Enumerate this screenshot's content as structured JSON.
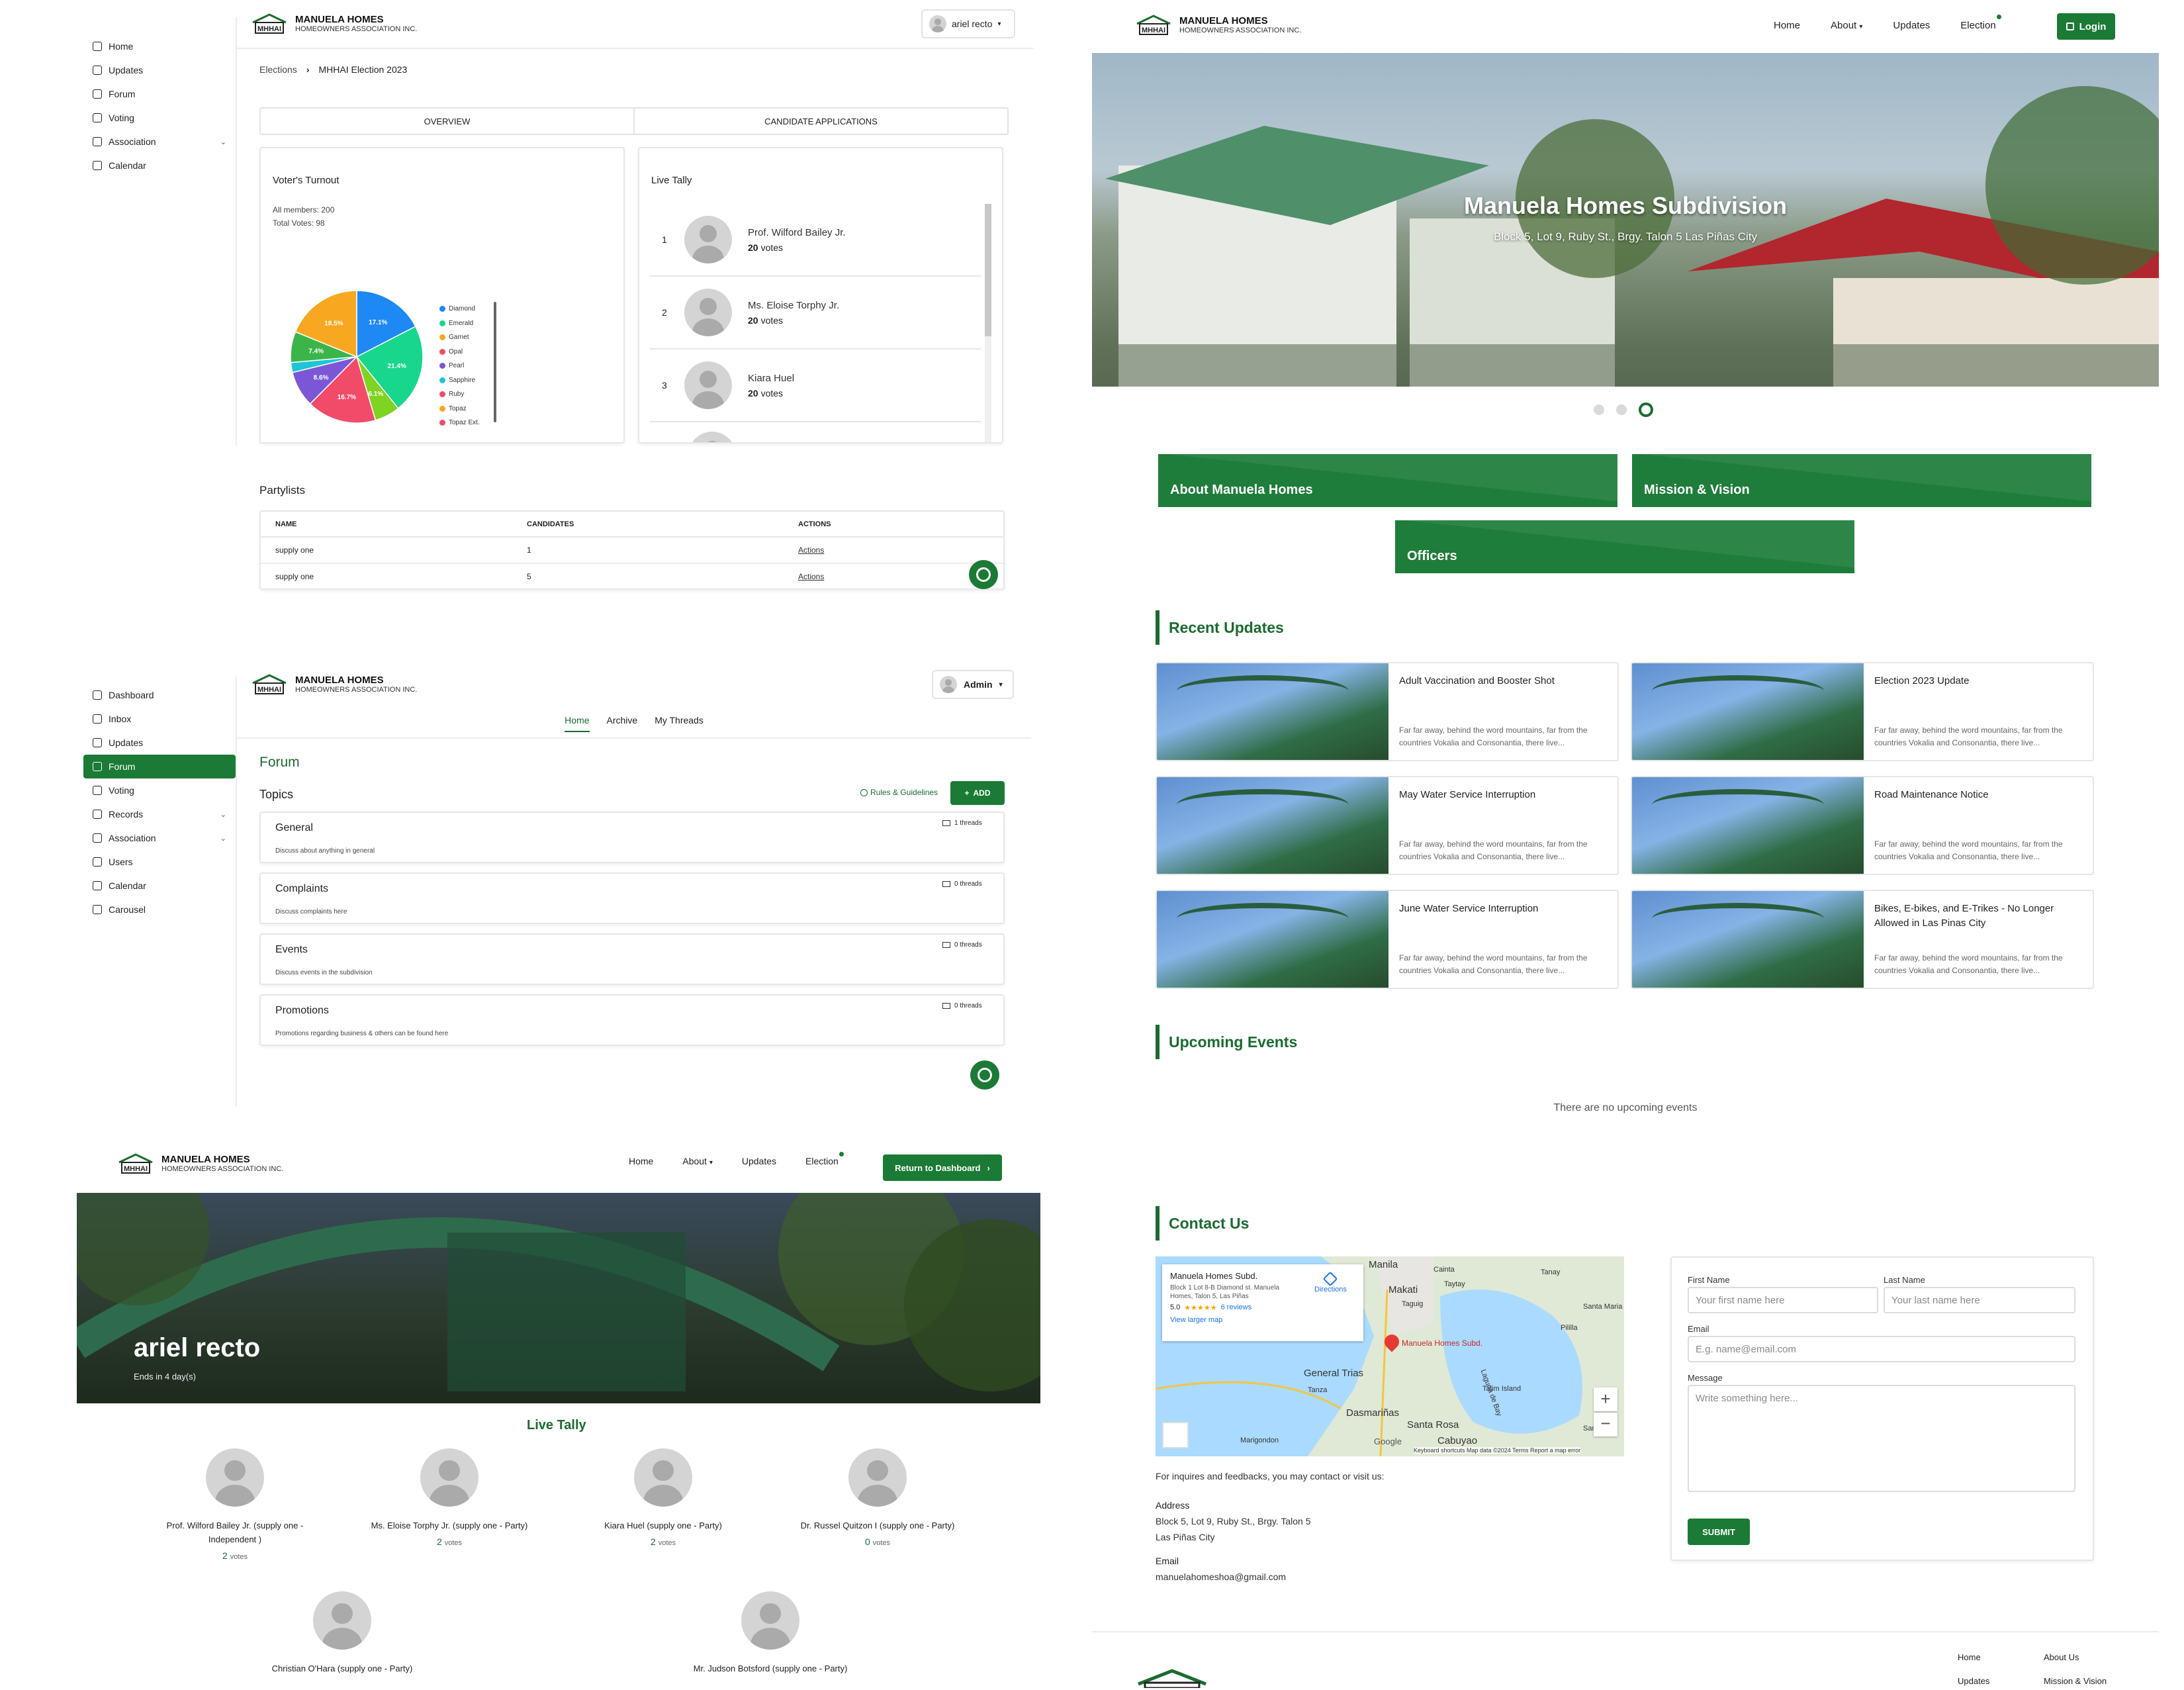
{
  "brand": {
    "name": "MANUELA HOMES",
    "subtitle": "HOMEOWNERS ASSOCIATION INC.",
    "logo_text": "MHHAI"
  },
  "colors": {
    "primary": "#1b7a35",
    "dark": "#1b6b30",
    "border": "#e6e6e6"
  },
  "election_admin": {
    "sidebar": [
      {
        "label": "Home",
        "icon": "home-icon"
      },
      {
        "label": "Updates",
        "icon": "megaphone-icon"
      },
      {
        "label": "Forum",
        "icon": "forum-icon"
      },
      {
        "label": "Voting",
        "icon": "vote-icon"
      },
      {
        "label": "Association",
        "icon": "building-icon",
        "chevron": true
      },
      {
        "label": "Calendar",
        "icon": "calendar-icon"
      }
    ],
    "user": "ariel recto",
    "breadcrumb": {
      "root": "Elections",
      "current": "MHHAI Election 2023"
    },
    "tabs": [
      "OVERVIEW",
      "CANDIDATE APPLICATIONS"
    ],
    "turnout": {
      "title": "Voter's Turnout",
      "members": "All members: 200",
      "votes": "Total Votes: 98"
    },
    "chart_data": {
      "type": "pie",
      "title": "",
      "slices": [
        {
          "label": "Diamond",
          "value": 17.1,
          "color": "#1e88f5"
        },
        {
          "label": "Emerald",
          "value": 21.4,
          "color": "#18d68c"
        },
        {
          "label": "Garnet",
          "value": 6.1,
          "color": "#7fd321"
        },
        {
          "label": "Opal",
          "value": 16.7,
          "color": "#f24b6a"
        },
        {
          "label": "Pearl",
          "value": 8.6,
          "color": "#7b57d8"
        },
        {
          "label": "Sapphire",
          "value": 2.4,
          "color": "#1ec5d6"
        },
        {
          "label": "Ruby",
          "value": 7.4,
          "color": "#3bb54a"
        },
        {
          "label": "Topaz",
          "value": 18.5,
          "color": "#f7a820"
        }
      ],
      "legend": [
        "Diamond",
        "Emerald",
        "Garnet",
        "Opal",
        "Pearl",
        "Sapphire",
        "Ruby",
        "Topaz",
        "Topaz Ext."
      ],
      "legend_colors": [
        "#1e88f5",
        "#18d68c",
        "#f7a820",
        "#f24b6a",
        "#7b57d8",
        "#1ec5d6",
        "#f24b6a",
        "#f7a820",
        "#f24b6a"
      ],
      "legend_placement": "right"
    },
    "tally": {
      "title": "Live Tally",
      "items": [
        {
          "rank": "1",
          "name": "Prof. Wilford Bailey Jr.",
          "votes": "20",
          "unit": "votes"
        },
        {
          "rank": "2",
          "name": "Ms. Eloise Torphy Jr.",
          "votes": "20",
          "unit": "votes"
        },
        {
          "rank": "3",
          "name": "Kiara Huel",
          "votes": "20",
          "unit": "votes"
        }
      ]
    },
    "partylists": {
      "title": "Partylists",
      "headers": [
        "NAME",
        "CANDIDATES",
        "ACTIONS"
      ],
      "rows": [
        {
          "name": "supply one",
          "candidates": "1",
          "action": "Actions"
        },
        {
          "name": "supply one",
          "candidates": "5",
          "action": "Actions"
        }
      ]
    }
  },
  "forum_admin": {
    "sidebar": [
      {
        "label": "Dashboard",
        "icon": "dashboard-icon"
      },
      {
        "label": "Inbox",
        "icon": "inbox-icon"
      },
      {
        "label": "Updates",
        "icon": "megaphone-icon"
      },
      {
        "label": "Forum",
        "icon": "forum-icon",
        "active": true
      },
      {
        "label": "Voting",
        "icon": "vote-icon"
      },
      {
        "label": "Records",
        "icon": "records-icon",
        "chevron": true
      },
      {
        "label": "Association",
        "icon": "building-icon",
        "chevron": true
      },
      {
        "label": "Users",
        "icon": "users-icon"
      },
      {
        "label": "Calendar",
        "icon": "calendar-icon"
      },
      {
        "label": "Carousel",
        "icon": "carousel-icon"
      }
    ],
    "user": "Admin",
    "subnav": [
      "Home",
      "Archive",
      "My Threads"
    ],
    "title": "Forum",
    "topics_label": "Topics",
    "rules": "Rules & Guidelines",
    "add": "ADD",
    "topics": [
      {
        "name": "General",
        "desc": "Discuss about anything in general",
        "threads": "1 threads"
      },
      {
        "name": "Complaints",
        "desc": "Discuss complaints here",
        "threads": "0 threads"
      },
      {
        "name": "Events",
        "desc": "Discuss events in the subdivision",
        "threads": "0 threads"
      },
      {
        "name": "Promotions",
        "desc": "Promotions regarding business & others can be found here",
        "threads": "0 threads"
      }
    ]
  },
  "election_public": {
    "nav": [
      "Home",
      "About",
      "Updates",
      "Election"
    ],
    "dashboard_btn": "Return to Dashboard",
    "hero_name": "ariel recto",
    "hero_sub": "Ends in 4 day(s)",
    "tally_title": "Live Tally",
    "candidates": [
      {
        "name": "Prof. Wilford Bailey Jr. (supply one - Independent )",
        "votes": "2",
        "unit": "votes"
      },
      {
        "name": "Ms. Eloise Torphy Jr. (supply one - Party)",
        "votes": "2",
        "unit": "votes"
      },
      {
        "name": "Kiara Huel (supply one - Party)",
        "votes": "2",
        "unit": "votes"
      },
      {
        "name": "Dr. Russel Quitzon I (supply one - Party)",
        "votes": "0",
        "unit": "votes"
      },
      {
        "name": "Christian O'Hara (supply one - Party)",
        "votes": "",
        "unit": ""
      },
      {
        "name": "Mr. Judson Botsford (supply one - Party)",
        "votes": "",
        "unit": ""
      }
    ]
  },
  "landing": {
    "nav": [
      "Home",
      "About",
      "Updates",
      "Election"
    ],
    "login": "Login",
    "hero_title": "Manuela Homes Subdivision",
    "hero_sub": "Block 5, Lot 9, Ruby St., Brgy. Talon 5 Las Piñas City",
    "tiles": [
      "About Manuela Homes",
      "Mission & Vision",
      "Officers"
    ],
    "recent_title": "Recent Updates",
    "updates": [
      {
        "title": "Adult Vaccination and Booster Shot",
        "desc": "Far far away, behind the word mountains, far from the countries Vokalia and Consonantia, there live..."
      },
      {
        "title": "Election 2023 Update",
        "desc": "Far far away, behind the word mountains, far from the countries Vokalia and Consonantia, there live..."
      },
      {
        "title": "May Water Service Interruption",
        "desc": "Far far away, behind the word mountains, far from the countries Vokalia and Consonantia, there live..."
      },
      {
        "title": "Road Maintenance Notice",
        "desc": "Far far away, behind the word mountains, far from the countries Vokalia and Consonantia, there live..."
      },
      {
        "title": "June Water Service Interruption",
        "desc": "Far far away, behind the word mountains, far from the countries Vokalia and Consonantia, there live..."
      },
      {
        "title": "Bikes, E-bikes, and E-Trikes - No Longer Allowed in Las Pinas City",
        "desc": "Far far away, behind the word mountains, far from the countries Vokalia and Consonantia, there live..."
      }
    ],
    "events_title": "Upcoming Events",
    "no_events": "There are no upcoming events",
    "contact_title": "Contact Us",
    "map": {
      "place": "Manuela Homes Subd.",
      "address": "Block 1 Lot 8-B Diamond st. Manuela Homes, Talon 5, Las Piñas",
      "rating": "5.0",
      "stars": "★★★★★",
      "reviews": "6 reviews",
      "directions": "Directions",
      "larger": "View larger map",
      "pin": "Manuela Homes Subd.",
      "labels": [
        "Manila",
        "Makati",
        "Cainta",
        "Taytay",
        "Taguig",
        "General Trias",
        "Tanza",
        "Dasmariñas",
        "Santa Rosa",
        "Cabuyao",
        "Marigondon",
        "Pililla",
        "Talim Island",
        "Tanay",
        "Santa Maria",
        "Laguna de Bay",
        "Santa"
      ],
      "attribution": "Keyboard shortcuts   Map data ©2024   Terms   Report a map error",
      "google": "Google"
    },
    "contact_intro": "For inquires and feedbacks, you may contact or visit us:",
    "address_label": "Address",
    "address_lines": [
      "Block 5, Lot 9, Ruby St., Brgy. Talon 5",
      "Las Piñas City"
    ],
    "email_label": "Email",
    "email": "manuelahomeshoa@gmail.com",
    "form": {
      "first_label": "First Name",
      "first_ph": "Your first name here",
      "last_label": "Last Name",
      "last_ph": "Your last name here",
      "email_label": "Email",
      "email_ph": "E.g. name@email.com",
      "msg_label": "Message",
      "msg_ph": "Write something here...",
      "submit": "SUBMIT"
    },
    "footer_links": [
      "Home",
      "About Us",
      "Updates",
      "Mission & Vision"
    ]
  }
}
